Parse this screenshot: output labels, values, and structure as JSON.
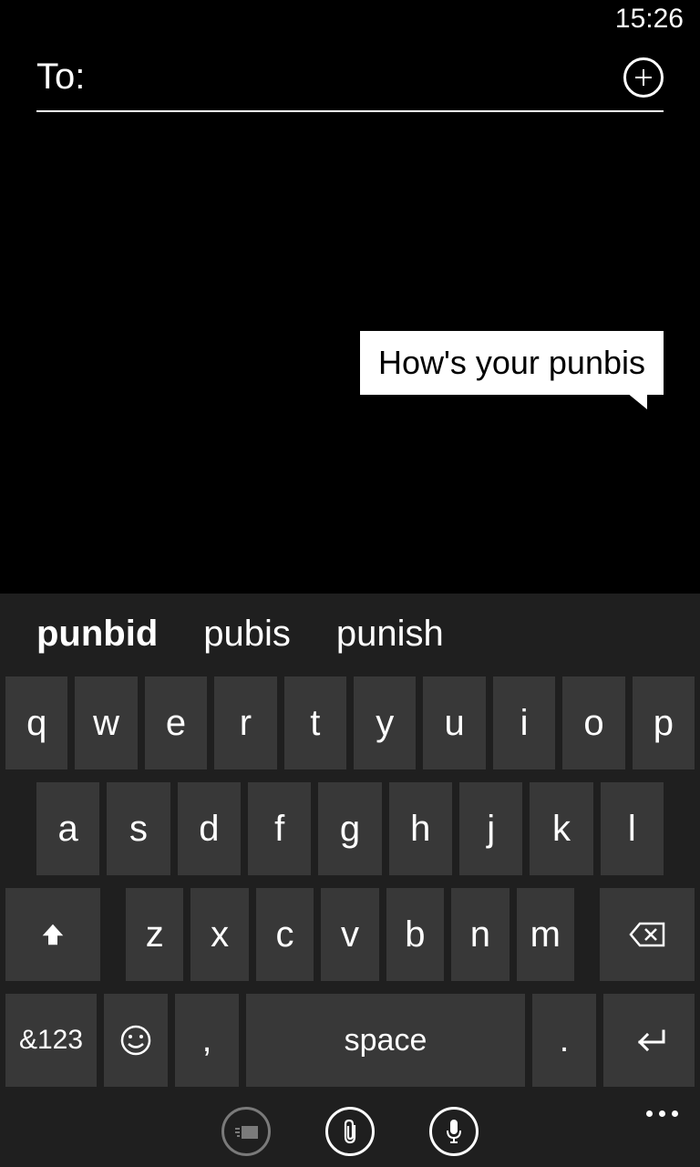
{
  "status": {
    "time": "15:26"
  },
  "compose": {
    "to_label": "To:",
    "to_value": ""
  },
  "message": {
    "draft_text": "How's your punbis"
  },
  "suggestions": [
    "punbid",
    "pubis",
    "punish"
  ],
  "keyboard": {
    "row1": [
      "q",
      "w",
      "e",
      "r",
      "t",
      "y",
      "u",
      "i",
      "o",
      "p"
    ],
    "row2": [
      "a",
      "s",
      "d",
      "f",
      "g",
      "h",
      "j",
      "k",
      "l"
    ],
    "row3": [
      "z",
      "x",
      "c",
      "v",
      "b",
      "n",
      "m"
    ],
    "sym_label": "&123",
    "space_label": "space",
    "comma": ",",
    "period": "."
  }
}
